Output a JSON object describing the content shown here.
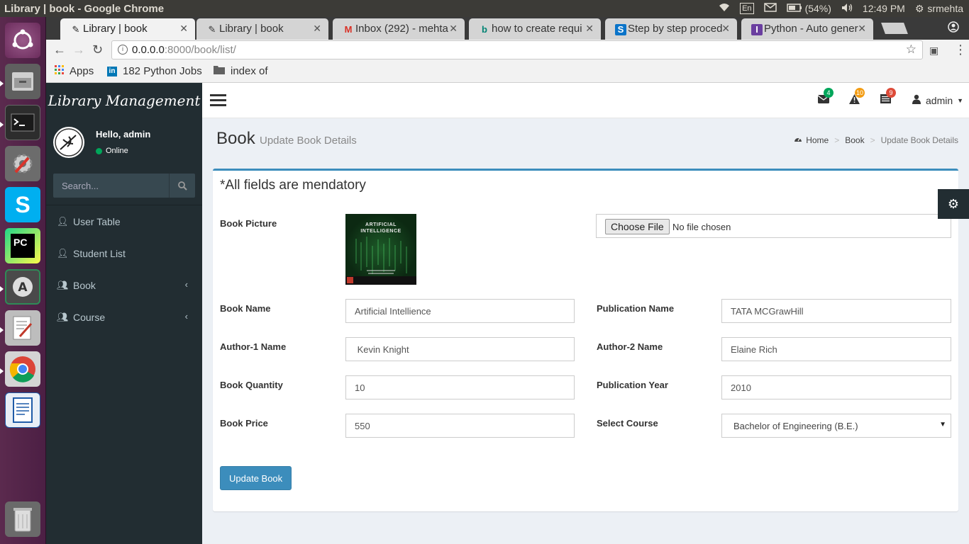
{
  "os_panel": {
    "window_title": "Library | book - Google Chrome",
    "keyboard": "En",
    "battery": "(54%)",
    "time": "12:49 PM",
    "user": "srmehta"
  },
  "launcher": {
    "apps": [
      "ubuntu-dash",
      "files",
      "terminal",
      "system-settings",
      "skype",
      "pycharm",
      "software-updater",
      "text-editor",
      "chrome",
      "libreoffice-writer",
      "trash"
    ]
  },
  "browser": {
    "tabs": [
      {
        "title": "Library | book",
        "favicon": "ink-icon",
        "active": true
      },
      {
        "title": "Library | book",
        "favicon": "ink-icon",
        "active": false
      },
      {
        "title": "Inbox (292) - mehta",
        "favicon": "gmail-icon",
        "active": false
      },
      {
        "title": "how to create requi",
        "favicon": "bing-icon",
        "active": false
      },
      {
        "title": "Step by step proced",
        "favicon": "sharepoint-icon",
        "active": false
      },
      {
        "title": "Python - Auto gener",
        "favicon": "python-doc-icon",
        "active": false
      }
    ],
    "url_host": "0.0.0.0",
    "url_rest": ":8000/book/list/",
    "bookmarks": [
      {
        "label": "Apps",
        "icon": "apps-grid-icon"
      },
      {
        "label": "182 Python Jobs",
        "icon": "linkedin-icon"
      },
      {
        "label": "index of",
        "icon": "folder-icon"
      }
    ]
  },
  "sidebar": {
    "brand": "Library Management",
    "user_greeting": "Hello, admin",
    "status": "Online",
    "search_placeholder": "Search...",
    "items": [
      {
        "label": "User Table",
        "icon": "user-icon",
        "has_children": false
      },
      {
        "label": "Student List",
        "icon": "user-icon",
        "has_children": false
      },
      {
        "label": "Book",
        "icon": "users-icon",
        "has_children": true
      },
      {
        "label": "Course",
        "icon": "users-icon",
        "has_children": true
      }
    ]
  },
  "navbar": {
    "messages_count": "4",
    "alerts_count": "10",
    "tasks_count": "9",
    "admin_label": "admin",
    "badge_colors": {
      "messages": "#00a65a",
      "alerts": "#f39c12",
      "tasks": "#dd4b39"
    }
  },
  "content": {
    "title": "Book",
    "subtitle": "Update Book Details",
    "breadcrumb": [
      "Home",
      "Book",
      "Update Book Details"
    ]
  },
  "form": {
    "heading": "*All fields are mendatory",
    "book_picture_label": "Book Picture",
    "cover_lines": [
      "ARTIFICIAL",
      "INTELLIGENCE"
    ],
    "choose_file_label": "Choose File",
    "no_file_text": "No file chosen",
    "book_name_label": "Book Name",
    "book_name_value": "Artificial Intellience",
    "publication_name_label": "Publication Name",
    "publication_name_value": "TATA MCGrawHill",
    "author1_label": "Author-1 Name",
    "author1_value": " Kevin Knight",
    "author2_label": "Author-2 Name",
    "author2_value": "Elaine Rich",
    "quantity_label": "Book Quantity",
    "quantity_value": "10",
    "year_label": "Publication Year",
    "year_value": "2010",
    "price_label": "Book Price",
    "price_value": "550",
    "course_label": "Select Course",
    "course_value": "Bachelor of Engineering (B.E.)",
    "submit_label": "Update Book"
  },
  "colors": {
    "accent": "#3c8dbc",
    "sidebar_bg": "#222d32",
    "page_bg": "#ecf0f5"
  }
}
